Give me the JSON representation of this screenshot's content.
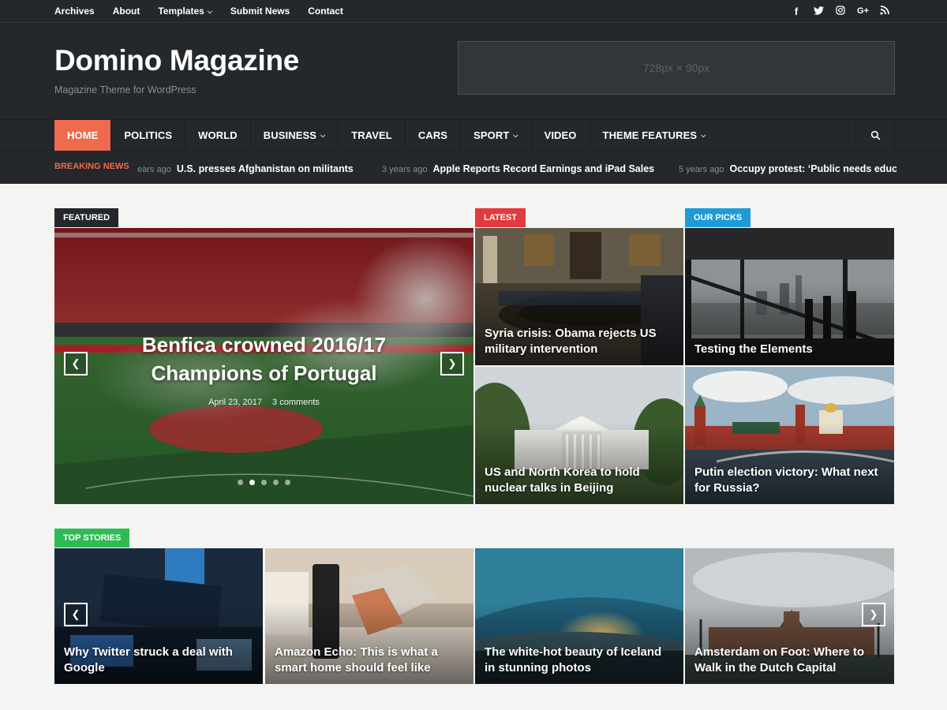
{
  "topbar": {
    "links": [
      "Archives",
      "About",
      "Templates",
      "Submit News",
      "Contact"
    ],
    "social_icons": [
      "facebook-icon",
      "twitter-icon",
      "instagram-icon",
      "google-plus-icon",
      "rss-icon"
    ]
  },
  "header": {
    "title": "Domino Magazine",
    "tagline": "Magazine Theme for WordPress",
    "ad_text": "728px × 90px"
  },
  "nav": {
    "items": [
      "HOME",
      "POLITICS",
      "WORLD",
      "BUSINESS",
      "TRAVEL",
      "CARS",
      "SPORT",
      "VIDEO",
      "THEME FEATURES"
    ]
  },
  "ticker": {
    "label": "BREAKING NEWS",
    "items": [
      {
        "ago": "ears ago",
        "title": "U.S. presses Afghanistan on militants"
      },
      {
        "ago": "3 years ago",
        "title": "Apple Reports Record Earnings and iPad Sales"
      },
      {
        "ago": "5 years ago",
        "title": "Occupy protest: ‘Public needs educa"
      }
    ]
  },
  "featured": {
    "label": "FEATURED",
    "title": "Benfica crowned 2016/17 Champions of Portugal",
    "date": "April 23, 2017",
    "comments": "3 comments"
  },
  "latest": {
    "label": "LATEST",
    "posts": [
      "Syria crisis: Obama rejects US military intervention",
      "US and North Korea to hold nuclear talks in Beijing"
    ]
  },
  "picks": {
    "label": "OUR PICKS",
    "posts": [
      "Testing the Elements",
      "Putin election victory: What next for Russia?"
    ]
  },
  "top_stories": {
    "label": "TOP STORIES",
    "posts": [
      "Why Twitter struck a deal with Google",
      "Amazon Echo: This is what a smart home should feel like",
      "The white-hot beauty of Iceland in stunning photos",
      "Amsterdam on Foot: Where to Walk in the Dutch Capital"
    ]
  },
  "colors": {
    "accent": "#ee6b4d",
    "featured_tag": "#24282b",
    "latest_tag": "#e23a3e",
    "picks_tag": "#1e9bd7",
    "top_stories_tag": "#2fba55"
  }
}
